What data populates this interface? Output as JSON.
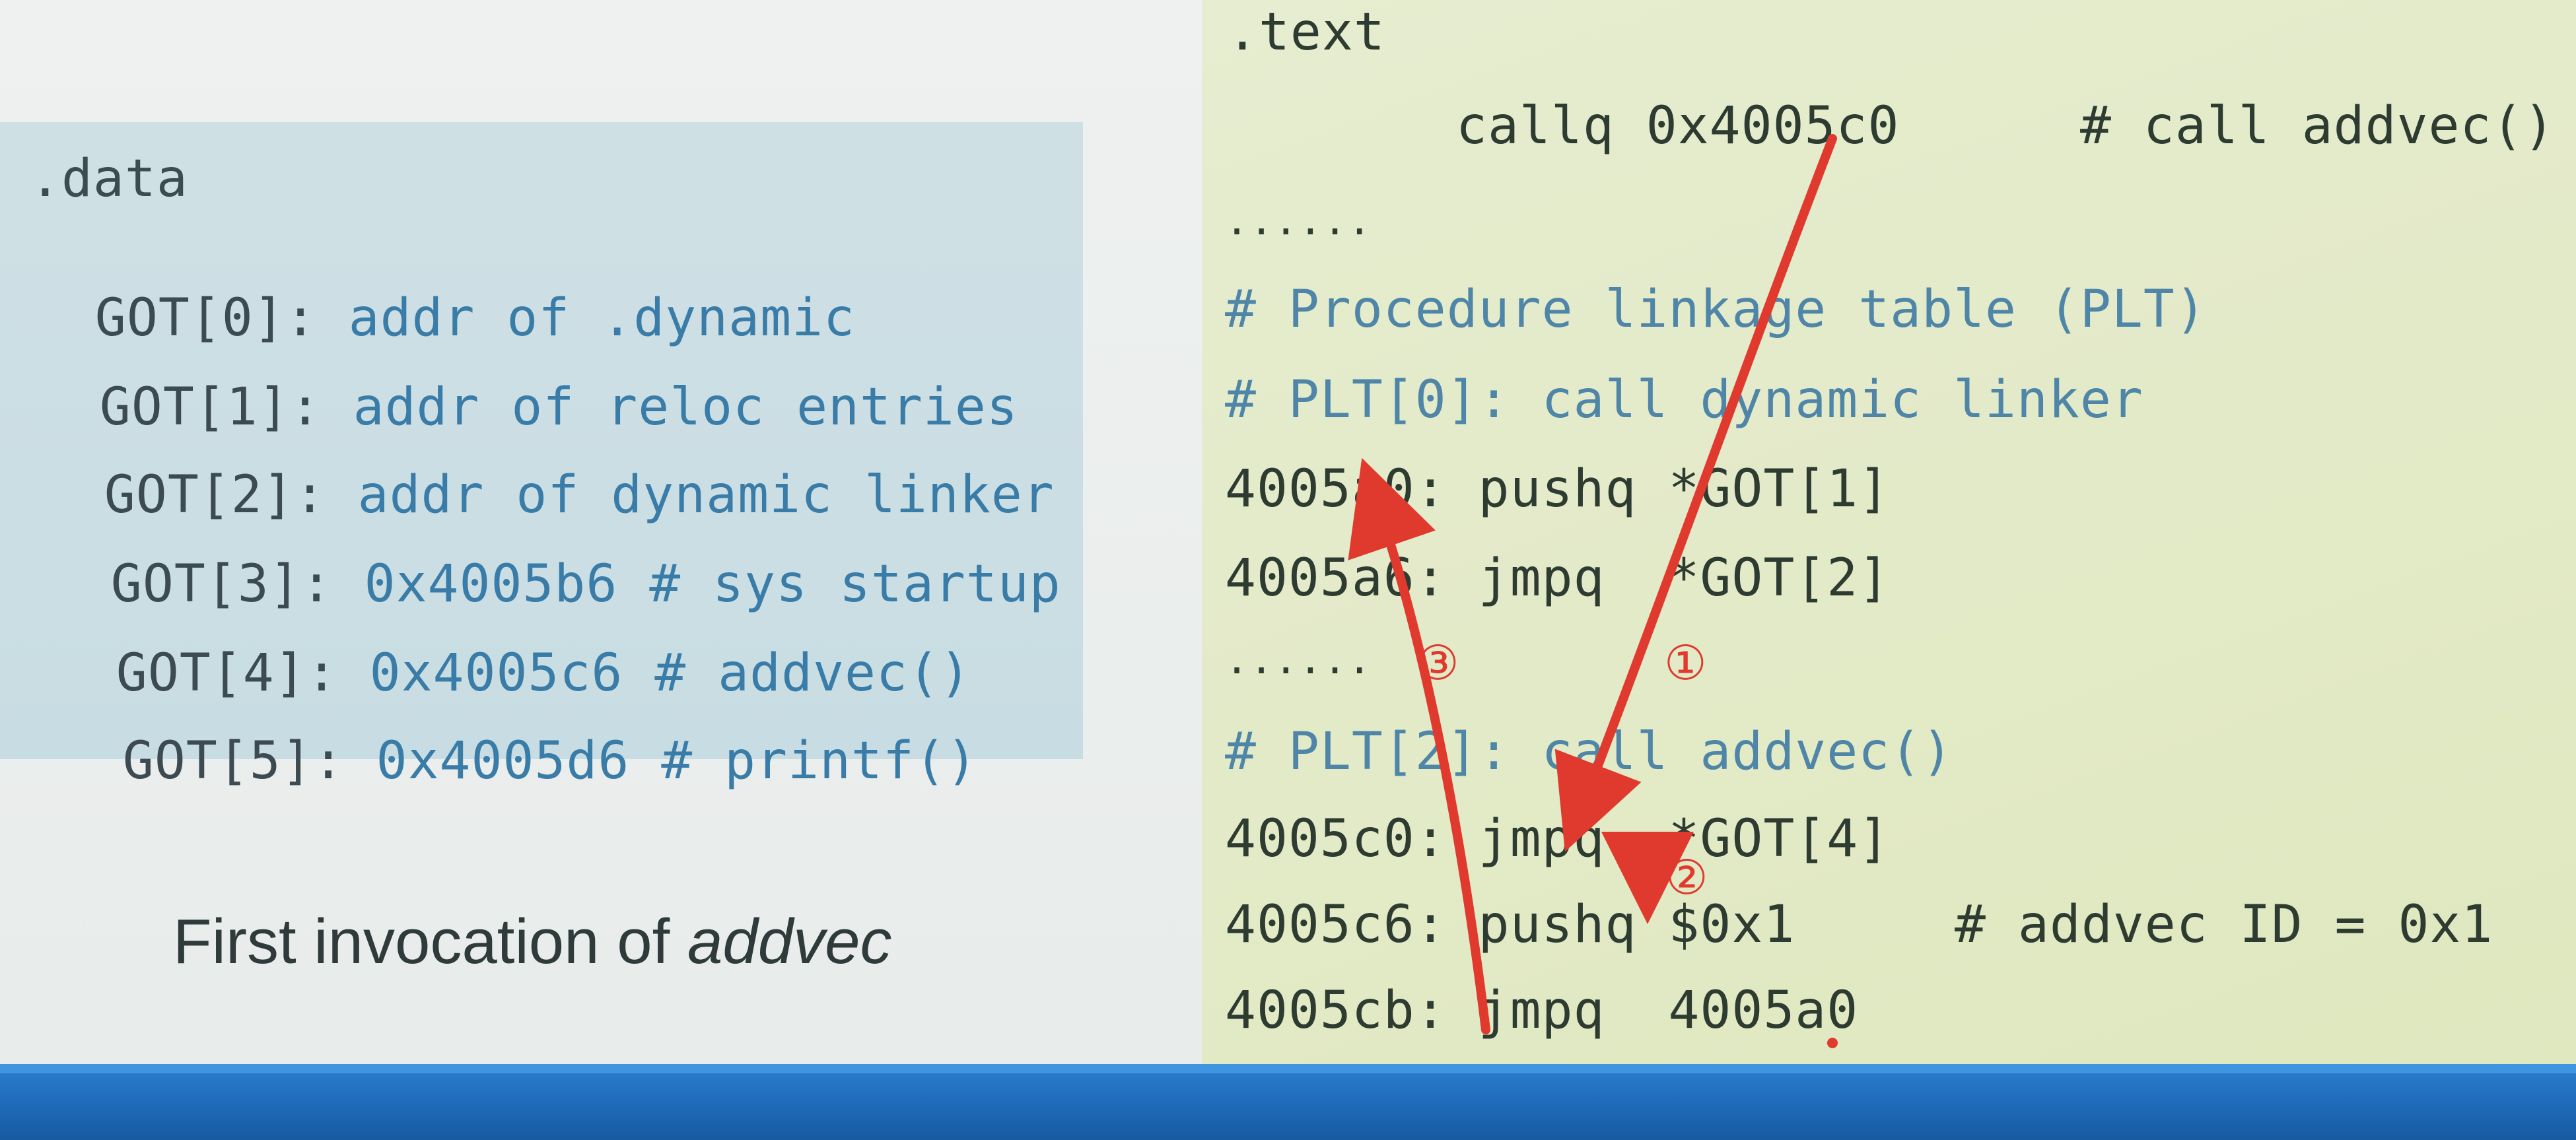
{
  "data_section": {
    "header": ".data",
    "entries": [
      {
        "label": "GOT[0]:",
        "value": "addr of .dynamic"
      },
      {
        "label": "GOT[1]:",
        "value": "addr of reloc entries"
      },
      {
        "label": "GOT[2]:",
        "value": "addr of dynamic linker"
      },
      {
        "label": "GOT[3]:",
        "value": "0x4005b6 # sys startup"
      },
      {
        "label": "GOT[4]:",
        "value": "0x4005c6 # addvec()"
      },
      {
        "label": "GOT[5]:",
        "value": "0x4005d6 # printf()"
      }
    ]
  },
  "caption": {
    "prefix": "First invocation of ",
    "emphasis": "addvec"
  },
  "text_section": {
    "header": ".text",
    "call_line": "callq 0x4005c0",
    "call_comment": "# call addvec()",
    "ellipsis_1": "......",
    "plt_comment": "# Procedure linkage table (PLT)",
    "plt0_comment": "# PLT[0]: call dynamic linker",
    "plt0_line1": "4005a0: pushq *GOT[1]",
    "plt0_line2": "4005a6: jmpq  *GOT[2]",
    "ellipsis_2": "......",
    "plt2_comment": "# PLT[2]: call addvec()",
    "plt2_line1": "4005c0: jmpq  *GOT[4]",
    "plt2_line2": "4005c6: pushq $0x1",
    "plt2_line2_comment": "# addvec ID = 0x1",
    "plt2_line3": "4005cb: jmpq  4005a0"
  },
  "annotations": {
    "step1": "①",
    "step2": "②",
    "step3": "③",
    "arrow_color": "#e0392e"
  }
}
